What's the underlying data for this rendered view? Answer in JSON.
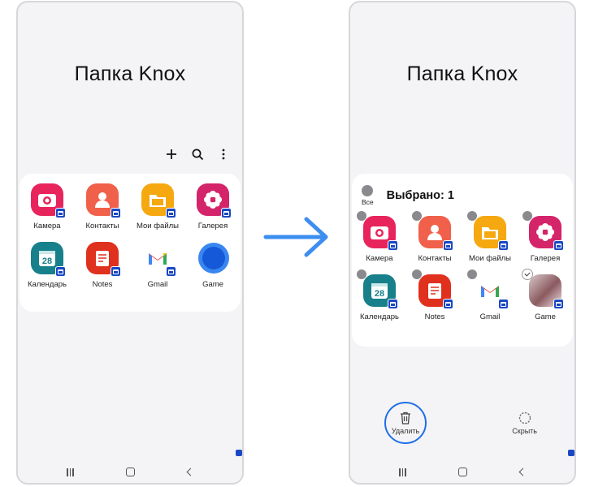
{
  "folder_title": "Папка Knox",
  "toolbar": {
    "add_icon": "plus-icon",
    "search_icon": "search-icon",
    "more_icon": "more-vert-icon"
  },
  "apps": [
    {
      "label": "Камера",
      "color": "#e8245c",
      "icon": "camera-icon"
    },
    {
      "label": "Контакты",
      "color": "#f0604a",
      "icon": "contact-icon"
    },
    {
      "label": "Мои файлы",
      "color": "#f5a810",
      "icon": "folder-icon"
    },
    {
      "label": "Галерея",
      "color": "#d4246a",
      "icon": "flower-icon"
    },
    {
      "label": "Календарь",
      "color": "#17808a",
      "icon": "calendar-icon",
      "day": "28"
    },
    {
      "label": "Notes",
      "color": "#e0301e",
      "icon": "notes-icon"
    },
    {
      "label": "Gmail",
      "color": "#ffffff",
      "icon": "gmail-icon"
    },
    {
      "label": "Game",
      "color": "#1f6ee8",
      "icon": "game-icon"
    }
  ],
  "selection": {
    "all_label": "Все",
    "selected_text": "Выбрано: 1"
  },
  "actions": {
    "delete_label": "Удалить",
    "hide_label": "Скрыть"
  },
  "colors": {
    "accent": "#1f6ee8",
    "knox_badge": "#1a48c4",
    "arrow": "#3d8ef0"
  }
}
